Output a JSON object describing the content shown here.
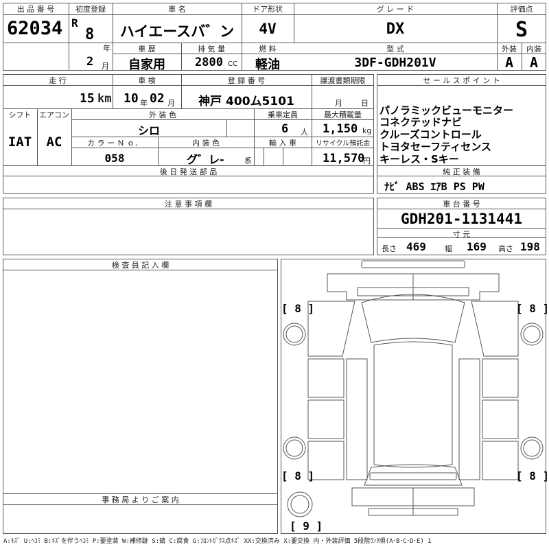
{
  "labels": {
    "lot_no": "出 品 番 号",
    "first_reg": "初度登録",
    "car_name": "車 名",
    "door": "ドア形状",
    "grade": "グ レ ー ド",
    "score": "評価点",
    "history": "車 歴",
    "displacement": "排 気 量",
    "fuel": "燃 料",
    "model": "型 式",
    "exterior": "外装",
    "interior": "内装",
    "mileage": "走 行",
    "inspection": "車 検",
    "reg_no": "登 録 番 号",
    "transfer": "譲渡書類期限",
    "sales_point": "セ ー ル ス ポ イ ン ト",
    "shift": "シフト",
    "aircon": "エアコン",
    "ext_color": "外 装 色",
    "capacity": "乗車定員",
    "max_load": "最大積載量",
    "color_no": "カ ラ ー Ｎ ｏ．",
    "int_color": "内 装 色",
    "import": "輸 入 車",
    "recycle": "リサイクル預託金",
    "later_parts": "後 日 発 送 部 品",
    "genuine": "純 正 装 備",
    "caution": "注 意 事 項 欄",
    "chassis": "車 台 番 号",
    "dimensions": "寸 元",
    "inspector": "検 査 員 記 入 欄",
    "office": "事 務 局 よ り ご 案 内"
  },
  "vehicle": {
    "lot_no": "62034",
    "era": "R",
    "year": "8",
    "month": "2",
    "car_name": "ハイエースバ゛ン",
    "door": "4V",
    "grade": "DX",
    "score": "S",
    "history": "自家用",
    "displacement": "2800",
    "fuel": "軽油",
    "model": "3DF-GDH201V",
    "exterior_grade": "A",
    "interior_grade": "A",
    "mileage": "15",
    "inspection_year": "10",
    "inspection_month": "02",
    "reg_no": "神戸 400ム5101",
    "shift": "IAT",
    "aircon": "AC",
    "ext_color": "シロ",
    "capacity": "6",
    "max_load": "1,150",
    "color_no": "058",
    "int_color": "グ゛レ-",
    "recycle": "11,570",
    "genuine": "ﾅﾋﾞ ABS ｴｱB PS PW",
    "chassis": "GDH201-1131441",
    "length": "469",
    "width": "169",
    "height": "198"
  },
  "units": {
    "year": "年",
    "month": "月",
    "cc": "CC",
    "km": "km",
    "person": "人",
    "kg": "kg",
    "yen": "円",
    "series": "系",
    "t_month": "月",
    "t_day": "日",
    "length": "長さ",
    "width": "幅",
    "height": "高さ"
  },
  "sales_points": [
    "パノラミックビューモニター",
    "コネクテッドナビ",
    "クルーズコントロール",
    "トヨタセーフティセンス",
    "キーレス・Sキー"
  ],
  "diagram": {
    "fl": "[ 8 ]",
    "fr": "[ 8 ]",
    "rl": "[ 8 ]",
    "rr": "[ 8 ]",
    "spare": "[ 9 ]"
  },
  "legend": "A:ｷｽﾞ U:ﾍｺﾐ B:ｷｽﾞを伴うﾍｺﾐ P:要塗装 W:補修跡 S:錆 C:腐食 G:ﾌﾛﾝﾄｶﾞﾗｽ点ｷｽﾞ XX:交換済み X:要交換 内・外装評価 5段階ﾗﾝｸ順(A･B･C･D･E) 1"
}
